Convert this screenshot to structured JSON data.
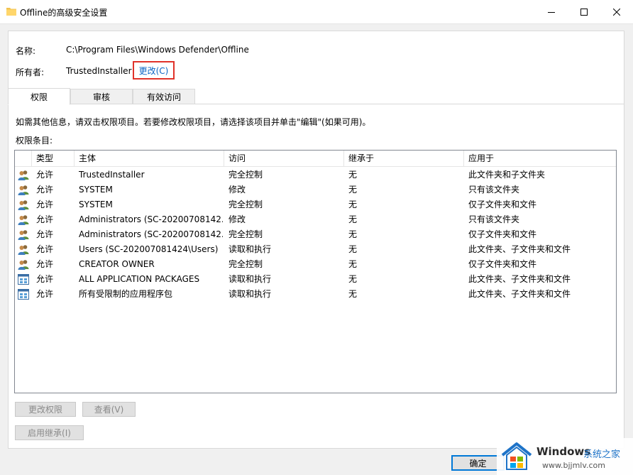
{
  "window": {
    "title": "Offline的高级安全设置",
    "controls": [
      "minimize",
      "maximize",
      "close"
    ]
  },
  "info": {
    "name_label": "名称:",
    "name_value": "C:\\Program Files\\Windows Defender\\Offline",
    "owner_label": "所有者:",
    "owner_value": "TrustedInstaller",
    "change_link": "更改(C)"
  },
  "tabs": [
    {
      "label": "权限",
      "active": true
    },
    {
      "label": "审核",
      "active": false
    },
    {
      "label": "有效访问",
      "active": false
    }
  ],
  "instruction": "如需其他信息，请双击权限项目。若要修改权限项目，请选择该项目并单击\"编辑\"(如果可用)。",
  "entries_label": "权限条目:",
  "columns": [
    "类型",
    "主体",
    "访问",
    "继承于",
    "应用于"
  ],
  "rows": [
    {
      "icon": "users-icon",
      "type": "允许",
      "principal": "TrustedInstaller",
      "access": "完全控制",
      "inherited": "无",
      "applies": "此文件夹和子文件夹"
    },
    {
      "icon": "users-icon",
      "type": "允许",
      "principal": "SYSTEM",
      "access": "修改",
      "inherited": "无",
      "applies": "只有该文件夹"
    },
    {
      "icon": "users-icon",
      "type": "允许",
      "principal": "SYSTEM",
      "access": "完全控制",
      "inherited": "无",
      "applies": "仅子文件夹和文件"
    },
    {
      "icon": "users-icon",
      "type": "允许",
      "principal": "Administrators (SC-20200708142...",
      "access": "修改",
      "inherited": "无",
      "applies": "只有该文件夹"
    },
    {
      "icon": "users-icon",
      "type": "允许",
      "principal": "Administrators (SC-20200708142...",
      "access": "完全控制",
      "inherited": "无",
      "applies": "仅子文件夹和文件"
    },
    {
      "icon": "users-icon",
      "type": "允许",
      "principal": "Users (SC-202007081424\\Users)",
      "access": "读取和执行",
      "inherited": "无",
      "applies": "此文件夹、子文件夹和文件"
    },
    {
      "icon": "users-icon",
      "type": "允许",
      "principal": "CREATOR OWNER",
      "access": "完全控制",
      "inherited": "无",
      "applies": "仅子文件夹和文件"
    },
    {
      "icon": "app-package-icon",
      "type": "允许",
      "principal": "ALL APPLICATION PACKAGES",
      "access": "读取和执行",
      "inherited": "无",
      "applies": "此文件夹、子文件夹和文件"
    },
    {
      "icon": "app-package-icon",
      "type": "允许",
      "principal": "所有受限制的应用程序包",
      "access": "读取和执行",
      "inherited": "无",
      "applies": "此文件夹、子文件夹和文件"
    }
  ],
  "buttons": {
    "change_permissions": "更改权限",
    "view": "查看(V)",
    "enable_inheritance": "启用继承(I)",
    "ok": "确定"
  },
  "watermark": {
    "brand": "Windows",
    "site": "系统之家",
    "url": "www.bjjmlv.com"
  },
  "colors": {
    "highlight_box": "#e0322a",
    "link": "#0a64c4",
    "accent": "#0078d7"
  }
}
